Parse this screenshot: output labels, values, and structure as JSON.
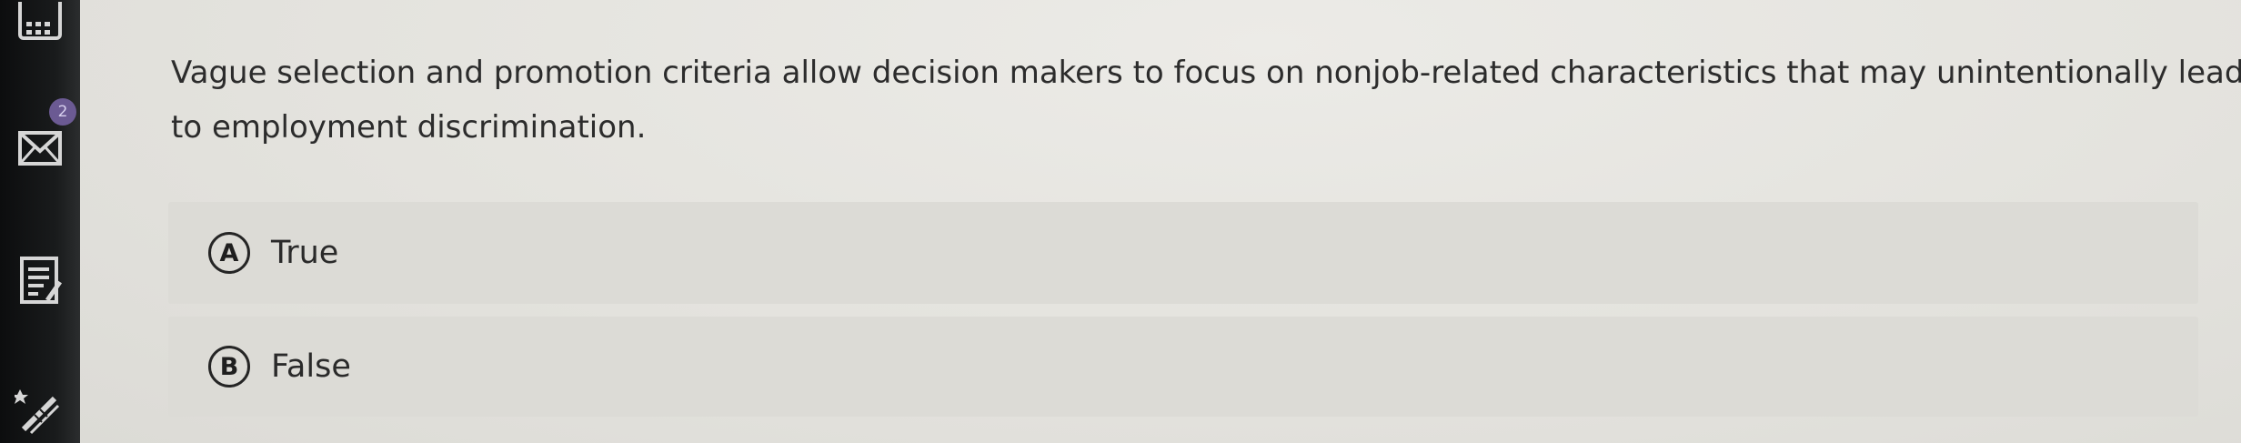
{
  "sidebar": {
    "icons": [
      {
        "name": "calendar-icon"
      },
      {
        "name": "mail-icon"
      },
      {
        "name": "notes-icon"
      },
      {
        "name": "tools-icon"
      }
    ],
    "badge": "2"
  },
  "question": {
    "text": "Vague selection and promotion criteria allow decision makers to focus on nonjob-related characteristics that may unintentionally lead to employment discrimination."
  },
  "options": [
    {
      "letter": "A",
      "label": "True"
    },
    {
      "letter": "B",
      "label": "False"
    }
  ]
}
